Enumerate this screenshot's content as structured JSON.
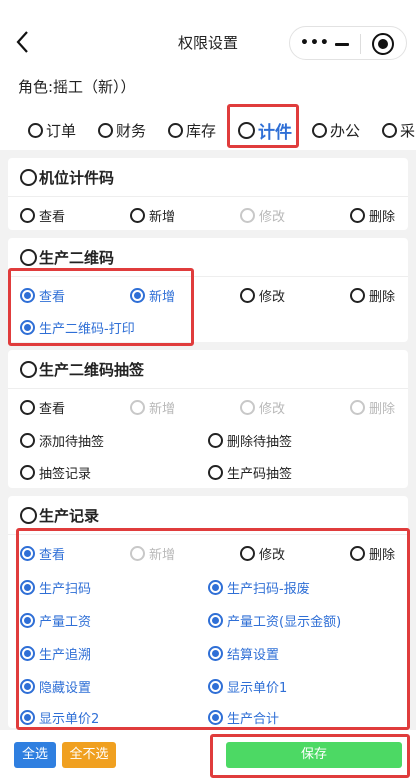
{
  "header": {
    "title": "权限设置",
    "capsule_dots": "•••"
  },
  "role_text": "角色:摇工（新））",
  "tabs": [
    {
      "label": "订单",
      "active": false
    },
    {
      "label": "财务",
      "active": false
    },
    {
      "label": "库存",
      "active": false
    },
    {
      "label": "计件",
      "active": true
    },
    {
      "label": "办公",
      "active": false
    },
    {
      "label": "采",
      "active": false
    }
  ],
  "sections": {
    "s1": {
      "title": "机位计件码",
      "opts": [
        "查看",
        "新增",
        "修改",
        "删除"
      ]
    },
    "s2": {
      "title": "生产二维码",
      "opts": [
        "查看",
        "新增",
        "修改",
        "删除",
        "生产二维码-打印"
      ]
    },
    "s3": {
      "title": "生产二维码抽签",
      "opts": [
        "查看",
        "新增",
        "修改",
        "删除",
        "添加待抽签",
        "删除待抽签",
        "抽签记录",
        "生产码抽签"
      ]
    },
    "s4": {
      "title": "生产记录",
      "opts": [
        "查看",
        "新增",
        "修改",
        "删除",
        "生产扫码",
        "生产扫码-报废",
        "产量工资",
        "产量工资(显示金额)",
        "生产追溯",
        "结算设置",
        "隐藏设置",
        "显示单价1",
        "显示单价2",
        "生产合计"
      ]
    }
  },
  "bottom": {
    "select_all": "全选",
    "select_none": "全不选",
    "save": "保存"
  },
  "colors": {
    "accent": "#2f6fd6",
    "highlight": "#e03c3c",
    "save": "#4cd964",
    "select_all": "#2f7fe0",
    "select_none": "#f0a020"
  }
}
